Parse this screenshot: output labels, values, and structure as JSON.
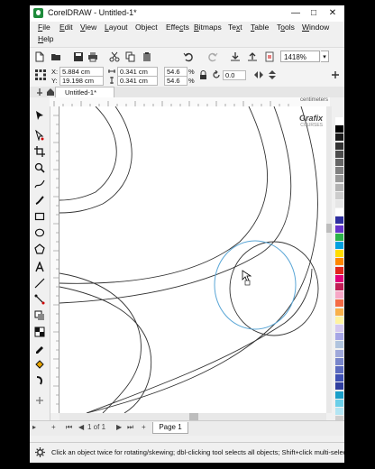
{
  "window": {
    "title": "CorelDRAW - Untitled-1*",
    "controls": {
      "minimize": "—",
      "maximize": "□",
      "close": "✕"
    }
  },
  "menu": [
    {
      "label": "File",
      "hotkey": "F"
    },
    {
      "label": "Edit",
      "hotkey": "E"
    },
    {
      "label": "View",
      "hotkey": "V"
    },
    {
      "label": "Layout",
      "hotkey": "L"
    },
    {
      "label": "Object",
      "hotkey": "j"
    },
    {
      "label": "Effects",
      "hotkey": "c"
    },
    {
      "label": "Bitmaps",
      "hotkey": "B"
    },
    {
      "label": "Text",
      "hotkey": "x"
    },
    {
      "label": "Table",
      "hotkey": "T"
    },
    {
      "label": "Tools",
      "hotkey": "o"
    },
    {
      "label": "Window",
      "hotkey": "W"
    },
    {
      "label": "Help",
      "hotkey": "H"
    }
  ],
  "toolbar": {
    "zoom_value": "1418%",
    "icons": [
      "new-icon",
      "open-icon",
      "save-icon",
      "print-icon",
      "cut-icon",
      "copy-icon",
      "paste-icon",
      "undo-icon",
      "redo-icon",
      "import-icon",
      "export-icon",
      "publish-pdf-icon"
    ]
  },
  "property_bar": {
    "x_label": "X:",
    "x_value": "5.884 cm",
    "y_label": "Y:",
    "y_value": "19.198 cm",
    "width_value": "0.341 cm",
    "height_value": "0.341 cm",
    "scale_w": "54.6",
    "scale_h": "54.6",
    "percent": "%",
    "rotation": "0.0"
  },
  "document_tab": {
    "label": "Untitled-1*"
  },
  "ruler": {
    "units": "centimeters"
  },
  "brand": {
    "name": "Grafix",
    "sub": "COURSES"
  },
  "pager": {
    "first": "⏮",
    "prev": "◀",
    "page_info": "1 of 1",
    "next": "▶",
    "last": "⏭",
    "add": "+",
    "page_tab": "Page 1"
  },
  "status": {
    "text": "Click an object twice for rotating/skewing; dbl-clicking tool selects all objects; Shift+click multi-selects; Alt+c"
  },
  "colors": {
    "selected_circle": "#5aa6d6",
    "accent": "#1d8a3a",
    "palette": [
      "#ffffff",
      "#000000",
      "#1a1a1a",
      "#333333",
      "#4d4d4d",
      "#666666",
      "#808080",
      "#999999",
      "#b3b3b3",
      "#cccccc",
      "#e6e6e6",
      "#ffffff",
      "#2e2ea0",
      "#6633cc",
      "#2cb34a",
      "#00a0e0",
      "#ffdd00",
      "#ff8800",
      "#e2261c",
      "#e2007a",
      "#c21e56",
      "#f7a7c6",
      "#f46b45",
      "#f9b04a",
      "#fff3a0",
      "#d4c8f0",
      "#a6a6e6",
      "#b0c4de",
      "#9fa8da",
      "#7986cb",
      "#5c6bc0",
      "#3f51b5",
      "#303f9f",
      "#1a9fc9",
      "#6bcfe8",
      "#b3e5f3",
      "#cfcfcf"
    ]
  }
}
